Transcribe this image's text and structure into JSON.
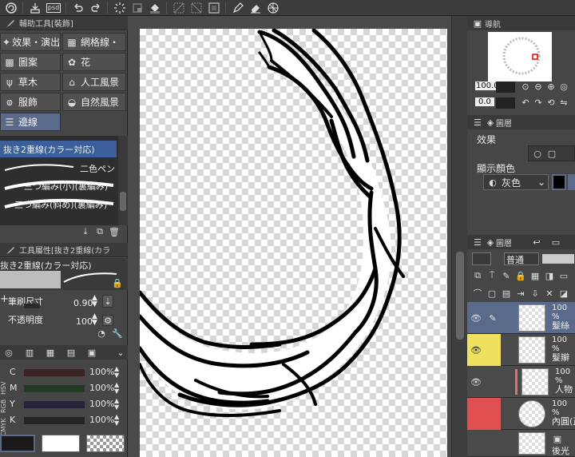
{
  "toolbar": {
    "icons": [
      "logo-icon",
      "print-icon",
      "psd-icon",
      "undo-icon",
      "redo-icon",
      "loading-icon",
      "clear-icon",
      "fill-icon",
      "transform-icon",
      "select-icon",
      "border-icon",
      "pen-icon",
      "eraser-icon",
      "grid-icon"
    ],
    "psd_label": "psd"
  },
  "sub_tool_panel": {
    "title": "輔助工具[裝飾]",
    "groups": [
      {
        "label": "效果・演出",
        "icon": "sparkle-icon"
      },
      {
        "label": "網格線・",
        "icon": "mesh-icon"
      },
      {
        "label": "圖案",
        "icon": "pattern-icon"
      },
      {
        "label": "花",
        "icon": "flower-icon"
      },
      {
        "label": "草木",
        "icon": "grass-icon"
      },
      {
        "label": "人工風景",
        "icon": "building-icon"
      },
      {
        "label": "服飾",
        "icon": "clothing-icon"
      },
      {
        "label": "自然風景",
        "icon": "landscape-icon"
      },
      {
        "label": "邊線",
        "icon": "border-lines-icon"
      }
    ],
    "brushes": [
      {
        "label": "抜き2重線(カラー対応)",
        "selected": true
      },
      {
        "label": "二色ペン",
        "selected": false
      },
      {
        "label": "三つ編み(小)(裏編み)",
        "selected": false
      },
      {
        "label": "三つ編み(斜め)(裏編み)",
        "selected": false
      }
    ]
  },
  "tool_property": {
    "title": "工具屬性[抜き2重線(カラ",
    "preset_name": "抜き2重線(カラー対応)",
    "brush_size_label": "筆刷尺寸",
    "brush_size_value": "0.90",
    "opacity_label": "不透明度",
    "opacity_value": "100"
  },
  "color_panel": {
    "mode_labels": [
      "HSV",
      "RGB",
      "CMYK"
    ],
    "rows": [
      {
        "channel": "C",
        "value": "100%",
        "color": "#3a2a2a"
      },
      {
        "channel": "M",
        "value": "100%",
        "color": "#2a3a2a"
      },
      {
        "channel": "Y",
        "value": "100%",
        "color": "#2a2a3a"
      },
      {
        "channel": "K",
        "value": "100%",
        "color": "#1a1a1a"
      }
    ],
    "main_color": "#1a1a1a",
    "sub_color": "#ffffff"
  },
  "navigator": {
    "title": "導航",
    "zoom": "100.0",
    "rotation": "0.0"
  },
  "layer_property": {
    "title": "圖層",
    "effect_label": "效果",
    "display_color_label": "顯示顏色",
    "display_color_value": "灰色"
  },
  "layers_panel": {
    "title": "圖層",
    "blend_mode": "普通",
    "layers": [
      {
        "name": "髮絲",
        "opacity": "100 %",
        "selected": true,
        "color_tag": "",
        "visible": true
      },
      {
        "name": "髮辮",
        "opacity": "100 %",
        "selected": false,
        "color_tag": "#f0e060",
        "visible": true
      },
      {
        "name": "人物",
        "opacity": "100 %",
        "selected": false,
        "color_tag": "",
        "visible": true
      },
      {
        "name": "內圓(正",
        "opacity": "100 %",
        "selected": false,
        "color_tag": "#e05050",
        "visible": false
      },
      {
        "name": "後光",
        "opacity": "",
        "selected": false,
        "color_tag": "",
        "visible": false
      }
    ]
  }
}
